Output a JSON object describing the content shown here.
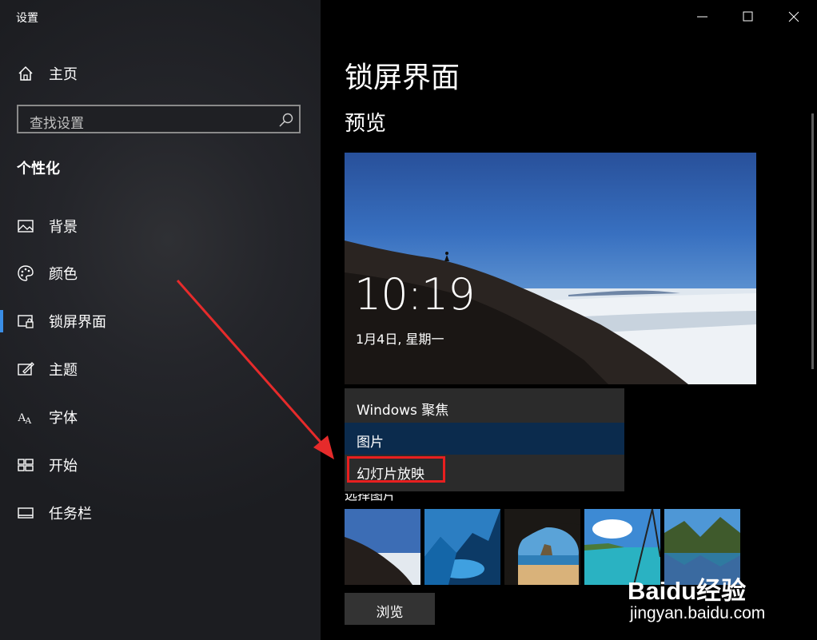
{
  "window": {
    "title": "设置"
  },
  "sidebar": {
    "home_label": "主页",
    "search_placeholder": "查找设置",
    "section": "个性化",
    "items": [
      {
        "label": "背景",
        "icon": "picture-icon"
      },
      {
        "label": "颜色",
        "icon": "palette-icon"
      },
      {
        "label": "锁屏界面",
        "icon": "lock-screen-icon",
        "active": true
      },
      {
        "label": "主题",
        "icon": "theme-icon"
      },
      {
        "label": "字体",
        "icon": "font-icon"
      },
      {
        "label": "开始",
        "icon": "start-icon"
      },
      {
        "label": "任务栏",
        "icon": "taskbar-icon"
      }
    ],
    "accent_color": "#3a8ee6"
  },
  "main": {
    "title": "锁屏界面",
    "preview_heading": "预览",
    "preview_time": "10:19",
    "preview_date": "1月4日, 星期一",
    "background_options": [
      "Windows 聚焦",
      "图片",
      "幻灯片放映"
    ],
    "selected_option": "图片",
    "highlighted_option": "幻灯片放映",
    "choose_picture_label": "选择图片",
    "browse_label": "浏览"
  },
  "watermark": {
    "brand": "Baidu经验",
    "url": "jingyan.baidu.com"
  },
  "colors": {
    "highlight_box": "#e81f1f",
    "selected_option_bg": "#0b2b4d",
    "arrow": "#e62b2b"
  }
}
